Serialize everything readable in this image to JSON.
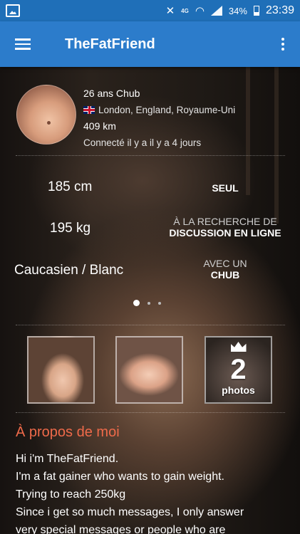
{
  "status_bar": {
    "network": "4G",
    "battery": "34%",
    "time": "23:39",
    "icons": [
      "gallery-icon",
      "mute-icon",
      "wifi-icon",
      "signal-icon",
      "battery-icon"
    ]
  },
  "app_bar": {
    "title": "TheFatFriend",
    "menu_icon": "menu-icon",
    "overflow_icon": "more-vert-icon"
  },
  "profile": {
    "headline": "26 ans Chub",
    "location": "London, England, Royaume-Uni",
    "distance": "409 km",
    "last_seen": "Connecté il y a il y a 4 jours"
  },
  "stats": {
    "height": "185 cm",
    "weight": "195 kg",
    "ethnicity": "Caucasien / Blanc",
    "status": "SEUL",
    "looking_for_label": "À LA RECHERCHE DE",
    "looking_for_value": "DISCUSSION EN LIGNE",
    "with_label": "AVEC UN",
    "with_value": "CHUB"
  },
  "pager": {
    "pages": 3,
    "active": 1
  },
  "photos": {
    "more_count": "2",
    "more_label": "photos"
  },
  "about": {
    "title": "À propos de moi",
    "lines": [
      "Hi i'm TheFatFriend.",
      "I'm a fat gainer who wants to gain weight.",
      "Trying to reach 250kg",
      "Since i get so much messages, I only answer",
      "very special messages or people who are"
    ]
  },
  "colors": {
    "status_bar": "#1f6fb8",
    "app_bar": "#2c7ccb",
    "accent": "#ef6a4a"
  }
}
